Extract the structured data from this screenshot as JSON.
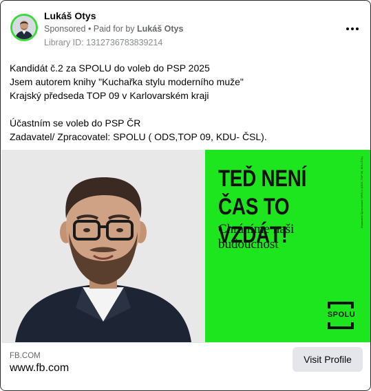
{
  "post": {
    "author": "Lukáš Otys",
    "sponsored_label": "Sponsored",
    "separator": " • ",
    "paid_for_prefix": "Paid for by ",
    "paid_for_name": "Lukáš Otys",
    "library_id": "Library ID: 1312736783839214",
    "more_icon": "more-horizontal-icon"
  },
  "body": {
    "lines": [
      "Kandidát č.2 za SPOLU do voleb do PSP 2025",
      "Jsem autorem knihy \"Kuchařka stylu moderního muže\"",
      "Krajský předseda TOP 09 v Karlovarském kraji",
      "",
      "Účastním se voleb do PSP ČR",
      "Zadavatel/ Zpracovatel: SPOLU ( ODS,TOP 09, KDU- ČSL)."
    ]
  },
  "ad_image": {
    "headline": "TEĎ NENÍ ČAS TO VZDÁT!",
    "subline_1": "Chráníme naši",
    "subline_2": "budoucnost",
    "logo_text": "SPOLU",
    "vertical_note": "Zadavatel/ Zpracovatel: SPOLU (ODS, TOP 09, KDU-ČSL)",
    "colors": {
      "panel": "#1ee61e",
      "text": "#111111"
    }
  },
  "link": {
    "domain_caption": "FB.COM",
    "domain": "www.fb.com",
    "cta_label": "Visit Profile"
  },
  "colors": {
    "avatar_ring": "#3cd83c",
    "secondary_text": "#65676b",
    "button_bg": "#e4e6eb"
  }
}
